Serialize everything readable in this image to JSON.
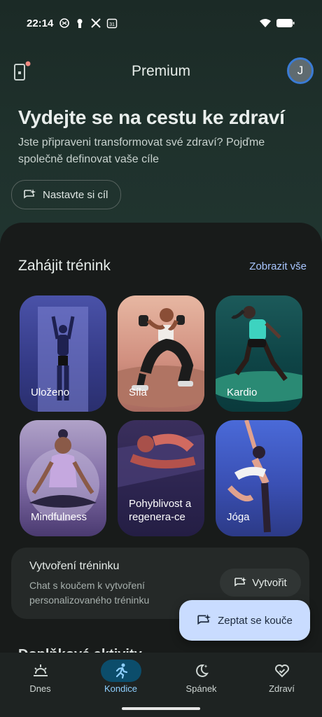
{
  "status": {
    "time": "22:14"
  },
  "header": {
    "title": "Premium",
    "avatar_letter": "J"
  },
  "hero": {
    "title": "Vydejte se na cestu ke zdraví",
    "subtitle": "Jste připraveni transformovat své zdraví? Pojďme společně definovat vaše cíle",
    "goal_button": "Nastavte si cíl"
  },
  "workouts": {
    "title": "Zahájit trénink",
    "see_all": "Zobrazit vše",
    "tiles": [
      {
        "label": "Uloženo"
      },
      {
        "label": "Síla"
      },
      {
        "label": "Kardio"
      },
      {
        "label": "Mindfulness"
      },
      {
        "label": "Pohyblivost a regenera-ce"
      },
      {
        "label": "Jóga"
      }
    ]
  },
  "builder": {
    "title": "Vytvoření tréninku",
    "subtitle": "Chat s koučem k vytvoření personalizovaného tréninku",
    "button": "Vytvořit"
  },
  "coach_button": "Zeptat se kouče",
  "peek_text": "Doplňkové aktivity",
  "nav": {
    "items": [
      {
        "label": "Dnes",
        "icon": "sunrise-icon"
      },
      {
        "label": "Kondice",
        "icon": "running-icon"
      },
      {
        "label": "Spánek",
        "icon": "moon-stars-icon"
      },
      {
        "label": "Zdraví",
        "icon": "heart-check-icon"
      }
    ],
    "active": "Kondice"
  },
  "colors": {
    "accent": "#a9c6ff",
    "active_nav": "#0c4d6b",
    "coach_button": "#c9dcff"
  }
}
